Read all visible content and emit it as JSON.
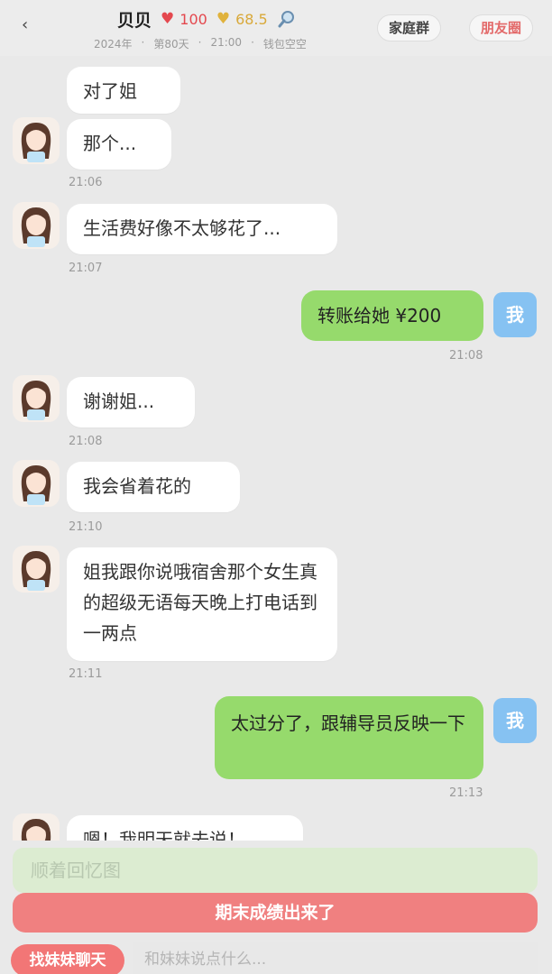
{
  "header": {
    "name": "贝贝",
    "love": "100",
    "coins": "68.5",
    "year": "2024年",
    "day": "第80天",
    "time": "21:00",
    "wallet": "钱包空空",
    "family_group": "家庭群",
    "moments": "朋友圈"
  },
  "me_label": "我",
  "messages": [
    {
      "text": "对了姐"
    },
    {
      "text": "那个...",
      "time": "21:06"
    },
    {
      "text": "生活费好像不太够花了...",
      "time": "21:07"
    },
    {
      "text": "转账给她 ¥200",
      "time": "21:08"
    },
    {
      "text": "谢谢姐...",
      "time": "21:08"
    },
    {
      "text": "我会省着花的",
      "time": "21:10"
    },
    {
      "text": "姐我跟你说哦宿舍那个女生真的超级无语每天晚上打电话到一两点",
      "time": "21:11"
    },
    {
      "text": "太过分了，跟辅导员反映一下",
      "time": "21:13"
    },
    {
      "text": "嗯！我明天就去说！"
    }
  ],
  "bottom": {
    "faded_input": "顺着回忆图",
    "exam_button": "期末成绩出来了",
    "chat_sister_button": "找妹妹聊天",
    "input_placeholder": "和妹妹说点什么..."
  },
  "colors": {
    "incoming_bubble": "#ffffff",
    "outgoing_bubble": "#96da6c",
    "me_tag": "#86c2f2",
    "accent_red": "#f08080",
    "love": "#e4484e",
    "coin": "#e0b23c"
  }
}
